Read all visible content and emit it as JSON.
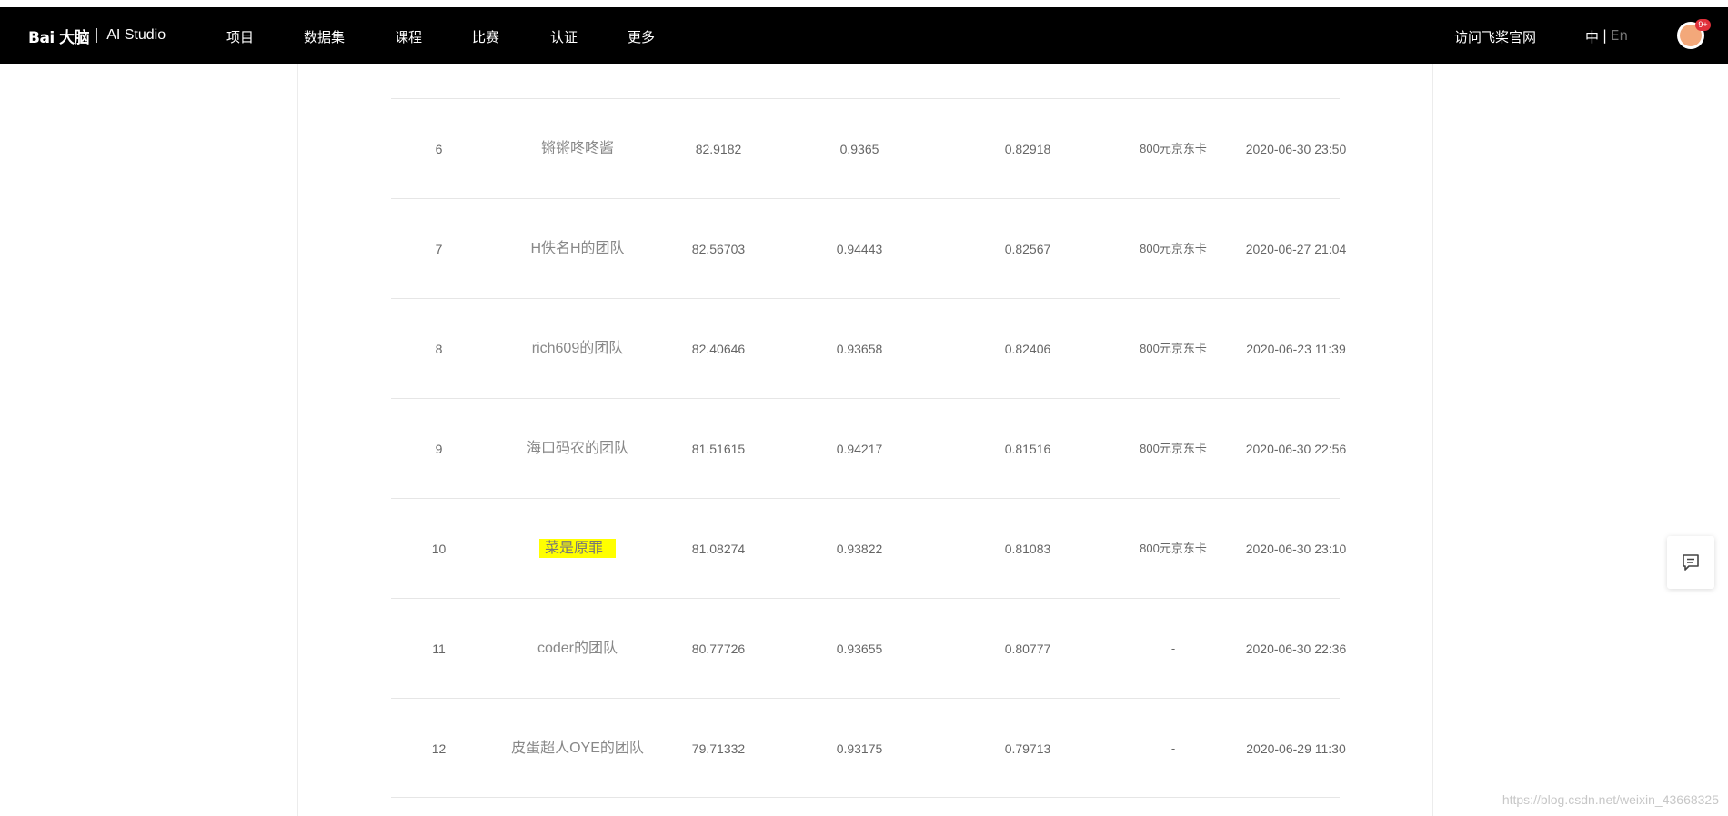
{
  "header": {
    "logo_text": "Bai 大脑",
    "studio_text": "AI Studio",
    "nav": [
      "项目",
      "数据集",
      "课程",
      "比赛",
      "认证",
      "更多"
    ],
    "visit_link": "访问飞桨官网",
    "lang_zh": "中",
    "lang_sep": "|",
    "lang_en": "En",
    "badge": "9+"
  },
  "leaderboard": {
    "rows": [
      {
        "rank": "6",
        "team": "锵锵咚咚酱",
        "score": "82.9182",
        "metric_a": "0.9365",
        "metric_b": "0.82918",
        "prize": "800元京东卡",
        "time": "2020-06-30 23:50"
      },
      {
        "rank": "7",
        "team": "H佚名H的团队",
        "score": "82.56703",
        "metric_a": "0.94443",
        "metric_b": "0.82567",
        "prize": "800元京东卡",
        "time": "2020-06-27 21:04"
      },
      {
        "rank": "8",
        "team": "rich609的团队",
        "score": "82.40646",
        "metric_a": "0.93658",
        "metric_b": "0.82406",
        "prize": "800元京东卡",
        "time": "2020-06-23 11:39"
      },
      {
        "rank": "9",
        "team": "海口码农的团队",
        "score": "81.51615",
        "metric_a": "0.94217",
        "metric_b": "0.81516",
        "prize": "800元京东卡",
        "time": "2020-06-30 22:56"
      },
      {
        "rank": "10",
        "team": "菜是原罪",
        "score": "81.08274",
        "metric_a": "0.93822",
        "metric_b": "0.81083",
        "prize": "800元京东卡",
        "time": "2020-06-30 23:10"
      },
      {
        "rank": "11",
        "team": "coder的团队",
        "score": "80.77726",
        "metric_a": "0.93655",
        "metric_b": "0.80777",
        "prize": "-",
        "time": "2020-06-30 22:36"
      },
      {
        "rank": "12",
        "team": "皮蛋超人OYE的团队",
        "score": "79.71332",
        "metric_a": "0.93175",
        "metric_b": "0.79713",
        "prize": "-",
        "time": "2020-06-29 11:30"
      }
    ],
    "highlight_color": "#ffff00"
  },
  "watermark": "https://blog.csdn.net/weixin_43668325",
  "icons": {
    "feedback": "chat-icon",
    "avatar": "bear-avatar-icon"
  }
}
